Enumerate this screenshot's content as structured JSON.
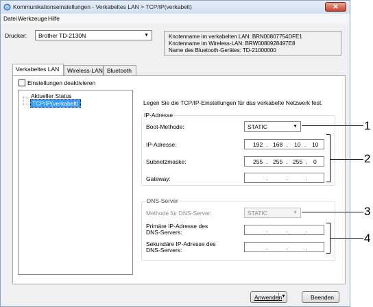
{
  "window": {
    "title": "Kommunikationseinstellungen - Verkabeltes LAN > TCP/IP(verkabelt)",
    "close_label": "✕"
  },
  "menu": [
    "Datei",
    "Werkzeuge",
    "Hilfe"
  ],
  "printer": {
    "label": "Drucker:",
    "value": "Brother TD-2130N"
  },
  "info": {
    "line1": "Knotenname im verkabelten LAN: BRN00807754DFE1",
    "line2": "Knotenname im Wireless-LAN: BRW0080928497E8",
    "line3": "Name des Bluetooth-Gerätes: TD-21000000"
  },
  "tabs": [
    "Verkabeltes LAN",
    "Wireless-LAN",
    "Bluetooth"
  ],
  "disable_settings_label": "Einstellungen deaktivieren",
  "tree": {
    "item1": "Aktueller Status",
    "item2": "TCP/IP(verkabelt)"
  },
  "description": "Legen Sie die TCP/IP-Einstellungen für das verkabelte Netzwerk fest.",
  "ip_section": {
    "legend": "IP-Adresse",
    "boot_label": "Boot-Methode:",
    "boot_value": "STATIC",
    "ip_label": "IP-Adresse:",
    "ip": [
      "192",
      "168",
      "10",
      "10"
    ],
    "subnet_label": "Subnetzmaske:",
    "subnet": [
      "255",
      "255",
      "255",
      "0"
    ],
    "gateway_label": "Gateway:",
    "gateway": [
      "",
      "",
      "",
      ""
    ]
  },
  "dns_section": {
    "legend": "DNS-Server",
    "method_label": "Methode für DNS-Server:",
    "method_value": "STATIC",
    "primary_label_1": "Primäre IP-Adresse des",
    "primary_label_2": "DNS-Servers:",
    "secondary_label_1": "Sekundäre IP-Adresse des",
    "secondary_label_2": "DNS-Servers:"
  },
  "buttons": {
    "apply": "Anwenden",
    "exit": "Beenden"
  },
  "callouts": [
    "1",
    "2",
    "3",
    "4"
  ]
}
